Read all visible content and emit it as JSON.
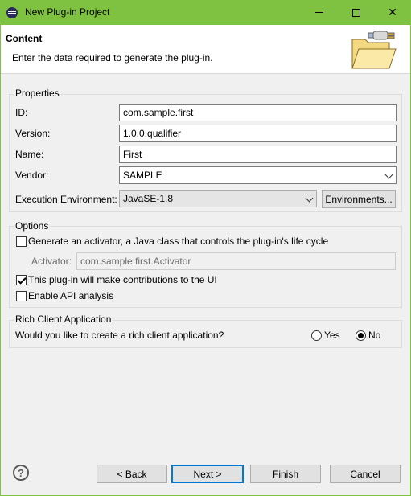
{
  "window": {
    "title": "New Plug-in Project",
    "accent": "#7fc241"
  },
  "header": {
    "title": "Content",
    "description": "Enter the data required to generate the plug-in."
  },
  "properties": {
    "group_label": "Properties",
    "id_label": "ID:",
    "id_value": "com.sample.first",
    "version_label": "Version:",
    "version_value": "1.0.0.qualifier",
    "name_label": "Name:",
    "name_value": "First",
    "vendor_label": "Vendor:",
    "vendor_value": "SAMPLE",
    "env_label": "Execution Environment:",
    "env_value": "JavaSE-1.8",
    "env_button": "Environments..."
  },
  "options": {
    "group_label": "Options",
    "activator_check_label": "Generate an activator, a Java class that controls the plug-in's life cycle",
    "activator_checked": false,
    "activator_label": "Activator:",
    "activator_value": "com.sample.first.Activator",
    "ui_check_label": "This plug-in will make contributions to the UI",
    "ui_checked": true,
    "api_check_label": "Enable API analysis",
    "api_checked": false
  },
  "rca": {
    "group_label": "Rich Client Application",
    "question": "Would you like to create a rich client application?",
    "yes_label": "Yes",
    "no_label": "No",
    "selected": "No"
  },
  "footer": {
    "help_icon": "help-icon",
    "back_label": "< Back",
    "next_label": "Next >",
    "finish_label": "Finish",
    "cancel_label": "Cancel"
  }
}
